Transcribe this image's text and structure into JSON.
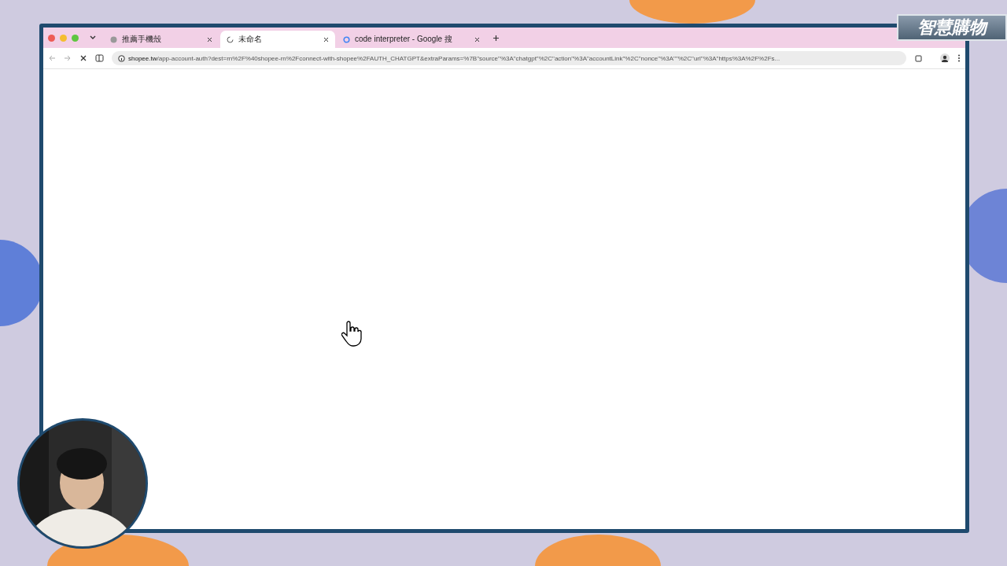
{
  "tabs": [
    {
      "label": "推薦手機殼",
      "selected": false
    },
    {
      "label": "未命名",
      "selected": true
    },
    {
      "label": "code interpreter - Google 搜",
      "selected": false
    }
  ],
  "address_bar": {
    "host": "shopee.tw",
    "path": "/app-account-auth?dest=rn%2F%40shopee-rn%2Fconnect-with-shopee%2FAUTH_CHATGPT&extraParams=%7B\"source\"%3A\"chatgpt\"%2C\"action\"%3A\"accountLink\"%2C\"nonce\"%3A\"\"%2C\"url\"%3A\"https%3A%2F%2Fs..."
  },
  "badge": "智慧購物"
}
